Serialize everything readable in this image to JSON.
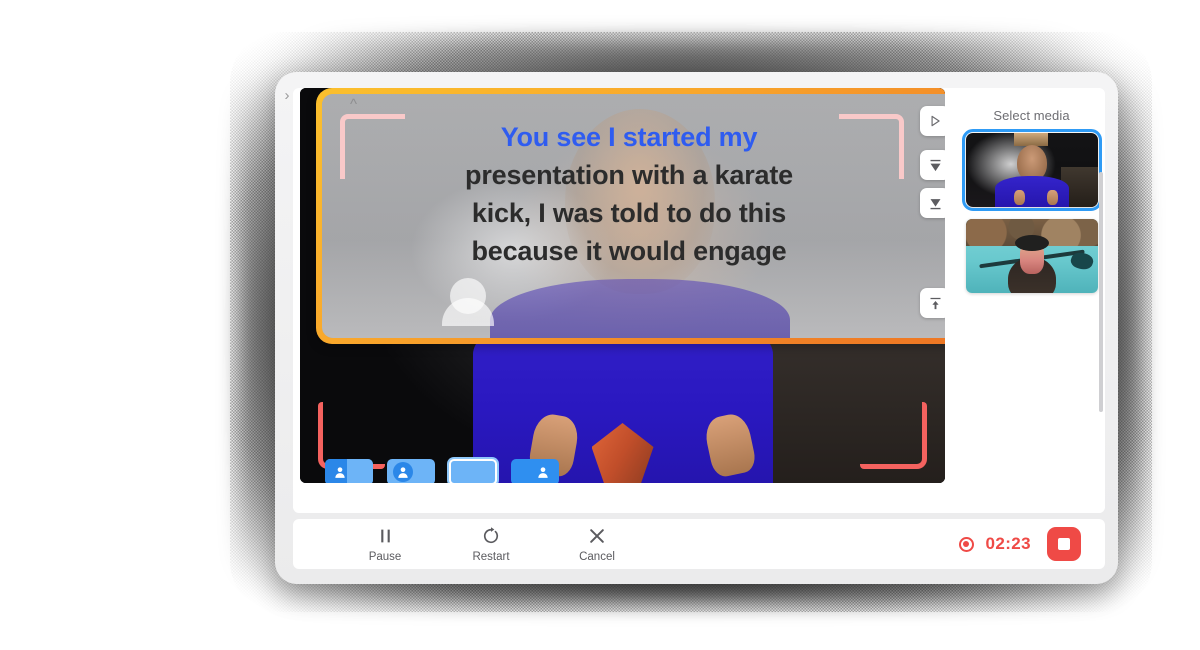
{
  "app": {
    "edge_chevron": "›"
  },
  "teleprompter": {
    "collapse_chevron": "^",
    "script_lines": [
      {
        "text": "You see I started my",
        "active": true
      },
      {
        "text": "presentation with a karate",
        "active": false
      },
      {
        "text": "kick, I was told to do this",
        "active": false
      },
      {
        "text": "because it would engage",
        "active": false
      }
    ],
    "active_line_color": "#2f5cf0",
    "inactive_line_color": "#2c2c2c",
    "frame_accent_color": "#ee7623",
    "bracket_color": "#f9c9c9",
    "controls": [
      {
        "name": "play-prompter-button",
        "icon": "play-icon"
      },
      {
        "name": "scroll-to-top-button",
        "icon": "scroll-top-icon"
      },
      {
        "name": "scroll-down-button",
        "icon": "scroll-down-icon"
      },
      {
        "name": "jump-to-start-button",
        "icon": "arrow-up-bar-icon"
      }
    ]
  },
  "video": {
    "framing_bracket_color": "#f4625f"
  },
  "layouts": [
    {
      "name": "layout-split-person-left",
      "selected": false
    },
    {
      "name": "layout-circle-person",
      "selected": false
    },
    {
      "name": "layout-fullscreen",
      "selected": true
    },
    {
      "name": "layout-person-right",
      "selected": false
    }
  ],
  "media_panel": {
    "title": "Select media",
    "selected_color": "#2f9bf5",
    "items": [
      {
        "name": "media-thumb-speaker",
        "kind": "speaker-video",
        "selected": true
      },
      {
        "name": "media-thumb-kayak",
        "kind": "kayak-photo",
        "selected": false
      }
    ]
  },
  "controlbar": {
    "buttons": [
      {
        "label": "Pause",
        "icon": "pause-icon",
        "name": "pause-button"
      },
      {
        "label": "Restart",
        "icon": "restart-icon",
        "name": "restart-button"
      },
      {
        "label": "Cancel",
        "icon": "close-icon",
        "name": "cancel-button"
      }
    ],
    "recording": {
      "time": "02:23",
      "color": "#ef4a46",
      "stop_name": "stop-recording-button"
    }
  }
}
